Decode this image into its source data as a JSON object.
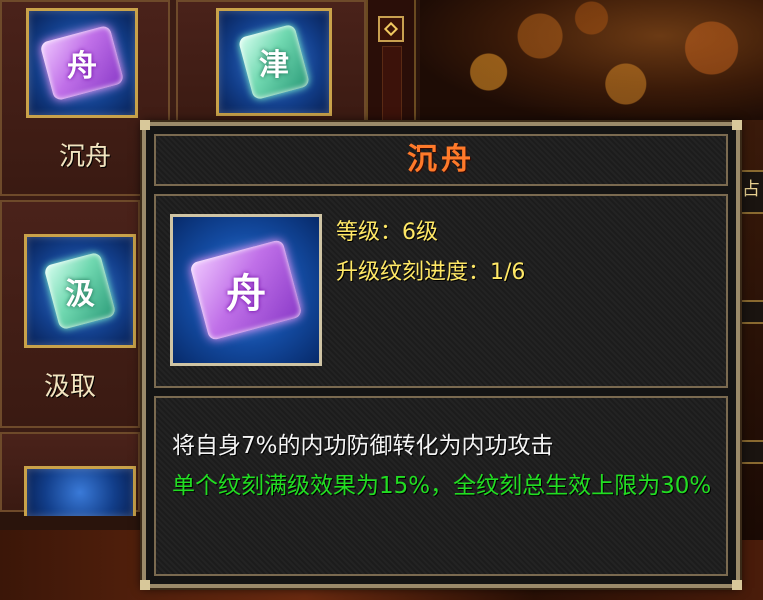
{
  "skills": [
    {
      "glyph": "舟",
      "name": "沉舟",
      "color": "purple"
    },
    {
      "glyph": "津",
      "name": "",
      "color": "green"
    },
    {
      "glyph": "汲",
      "name": "汲取",
      "color": "green"
    },
    {
      "glyph": "",
      "name": "",
      "color": "purple"
    }
  ],
  "side_tab_text": "占",
  "tooltip": {
    "title": "沉舟",
    "icon_glyph": "舟",
    "level_line": "等级：6级",
    "progress_line": "升级纹刻进度：1/6",
    "description": "将自身7%的内功防御转化为内功攻击",
    "bonus": "单个纹刻满级效果为15%，全纹刻总生效上限为30%"
  },
  "colors": {
    "title": "#ff7a2a",
    "info_text": "#ffe866",
    "description_text": "#f4f4f4",
    "bonus_text": "#22dd22",
    "border_gold": "#c9a24a"
  }
}
